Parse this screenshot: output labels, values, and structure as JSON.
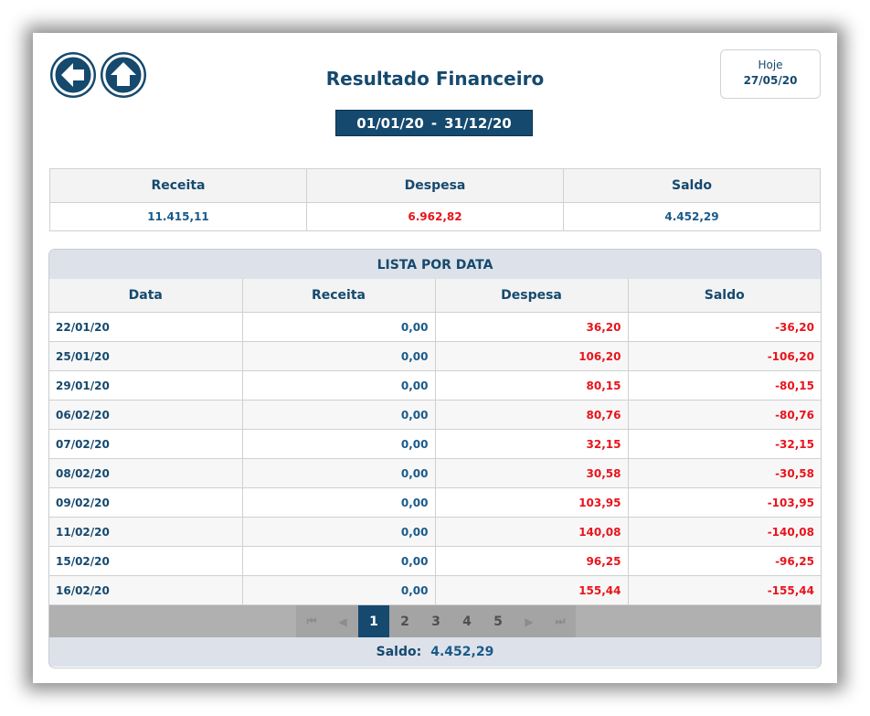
{
  "header": {
    "title": "Resultado Financeiro",
    "period_start": "01/01/20",
    "period_sep": "-",
    "period_end": "31/12/20",
    "today_label": "Hoje",
    "today_value": "27/05/20",
    "back_icon": "arrow-left-icon",
    "home_icon": "arrow-up-icon"
  },
  "summary": {
    "headers": [
      "Receita",
      "Despesa",
      "Saldo"
    ],
    "values": [
      "11.415,11",
      "6.962,82",
      "4.452,29"
    ]
  },
  "list": {
    "title": "LISTA POR DATA",
    "columns": [
      "Data",
      "Receita",
      "Despesa",
      "Saldo"
    ],
    "rows": [
      [
        "22/01/20",
        "0,00",
        "36,20",
        "-36,20"
      ],
      [
        "25/01/20",
        "0,00",
        "106,20",
        "-106,20"
      ],
      [
        "29/01/20",
        "0,00",
        "80,15",
        "-80,15"
      ],
      [
        "06/02/20",
        "0,00",
        "80,76",
        "-80,76"
      ],
      [
        "07/02/20",
        "0,00",
        "32,15",
        "-32,15"
      ],
      [
        "08/02/20",
        "0,00",
        "30,58",
        "-30,58"
      ],
      [
        "09/02/20",
        "0,00",
        "103,95",
        "-103,95"
      ],
      [
        "11/02/20",
        "0,00",
        "140,08",
        "-140,08"
      ],
      [
        "15/02/20",
        "0,00",
        "96,25",
        "-96,25"
      ],
      [
        "16/02/20",
        "0,00",
        "155,44",
        "-155,44"
      ]
    ]
  },
  "pagination": {
    "first": "⏮",
    "prev": "◀",
    "pages": [
      "1",
      "2",
      "3",
      "4",
      "5"
    ],
    "active_page": "1",
    "next": "▶",
    "last": "⏭"
  },
  "footer": {
    "label": "Saldo:",
    "value": "4.452,29"
  },
  "colors": {
    "primary": "#15496e",
    "positive": "#1a5a8a",
    "negative": "#e8141c"
  }
}
